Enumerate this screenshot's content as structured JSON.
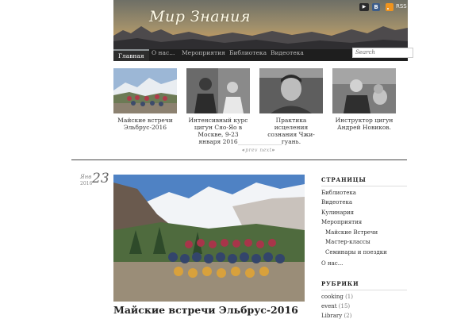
{
  "site": {
    "title": "Мир Знания",
    "social": {
      "youtube": "You Tube",
      "vk": "В",
      "rss": "RSS"
    }
  },
  "nav": {
    "items": [
      "Главная",
      "О нас...",
      "Мероприятия",
      "Библиотека",
      "Видеотека"
    ],
    "active": "Главная",
    "search_placeholder": "Search"
  },
  "featured": [
    {
      "caption": "Майские встречи Эльбрус-2016",
      "thumb": "group-photo-mountains"
    },
    {
      "caption": "Интенсивный курс цигун Сяо-Яо в Москве, 9-23 января 2016",
      "thumb": "bw-teacher-session"
    },
    {
      "caption": "Практика исцеления сознания Чжи-гуань.",
      "thumb": "bw-smiling-man"
    },
    {
      "caption": "Инструктор цигун Андрей Новиков.",
      "thumb": "bw-man-with-dog"
    }
  ],
  "pager": {
    "prev": "prev",
    "next": "next"
  },
  "post": {
    "month": "Янв",
    "year": "2016",
    "day": "23",
    "title": "Майские встречи Эльбрус-2016",
    "image": "group-photo-elbrus"
  },
  "sidebar": {
    "pages_title": "СТРАНИЦЫ",
    "pages": [
      {
        "label": "Библиотека",
        "level": 0
      },
      {
        "label": "Видеотека",
        "level": 0
      },
      {
        "label": "Кулинария",
        "level": 0
      },
      {
        "label": "Мероприятия",
        "level": 0
      },
      {
        "label": "Майские Встречи",
        "level": 1
      },
      {
        "label": "Мастер-классы",
        "level": 1
      },
      {
        "label": "Семинары и поездки",
        "level": 1
      },
      {
        "label": "О нас...",
        "level": 0
      }
    ],
    "rubrics_title": "РУБРИКИ",
    "rubrics": [
      {
        "label": "cooking",
        "count": "(1)"
      },
      {
        "label": "event",
        "count": "(15)"
      },
      {
        "label": "Library",
        "count": "(2)"
      }
    ]
  },
  "colors": {
    "nav_bg": "#1e1e1e",
    "nav_active": "#2d2d2d",
    "sunset_top": "#7d7a6d",
    "sunset_bottom": "#e0a24f",
    "link": "#333333"
  }
}
